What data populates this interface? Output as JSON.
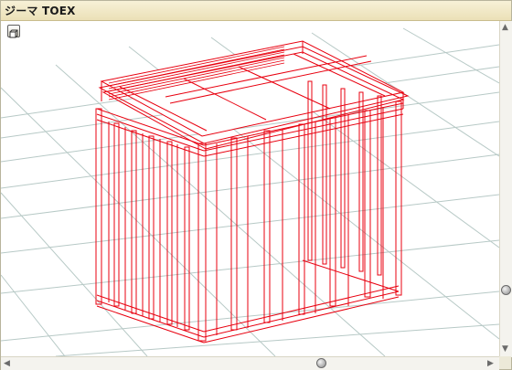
{
  "window": {
    "title": "ジーマ TOEX"
  },
  "colors": {
    "wireframe": "#e8000f",
    "grid": "#b7c9c6",
    "titlebar": "#f0e8c8",
    "background": "#ffffff"
  },
  "icons": {
    "view_mode": "view-mode-icon",
    "scroll_left": "scroll-left-icon",
    "scroll_right": "scroll-right-icon",
    "scroll_up": "scroll-up-icon",
    "scroll_down": "scroll-down-icon"
  }
}
